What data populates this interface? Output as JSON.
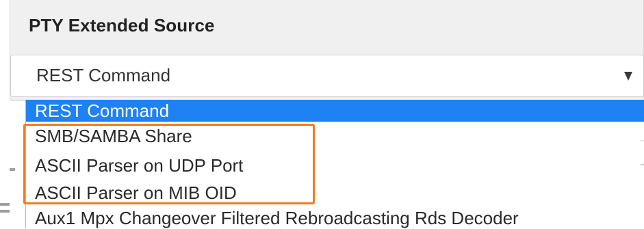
{
  "panel": {
    "title": "PTY Extended Source"
  },
  "select": {
    "selected_value": "REST Command"
  },
  "dropdown": {
    "options": [
      {
        "label": "REST Command",
        "selected": true
      },
      {
        "label": "SMB/SAMBA Share",
        "selected": false
      },
      {
        "label": "ASCII Parser on UDP Port",
        "selected": false
      },
      {
        "label": "ASCII Parser on MIB OID",
        "selected": false
      },
      {
        "label": "Aux1 Mpx Changeover Filtered Rebroadcasting Rds Decoder",
        "selected": false
      }
    ]
  },
  "colors": {
    "selected_option_bg": "#1e82f5",
    "highlight_border": "#f47920",
    "panel_bg": "#f0f0f0"
  },
  "icons": {
    "select_arrow": "caret-down-icon"
  }
}
